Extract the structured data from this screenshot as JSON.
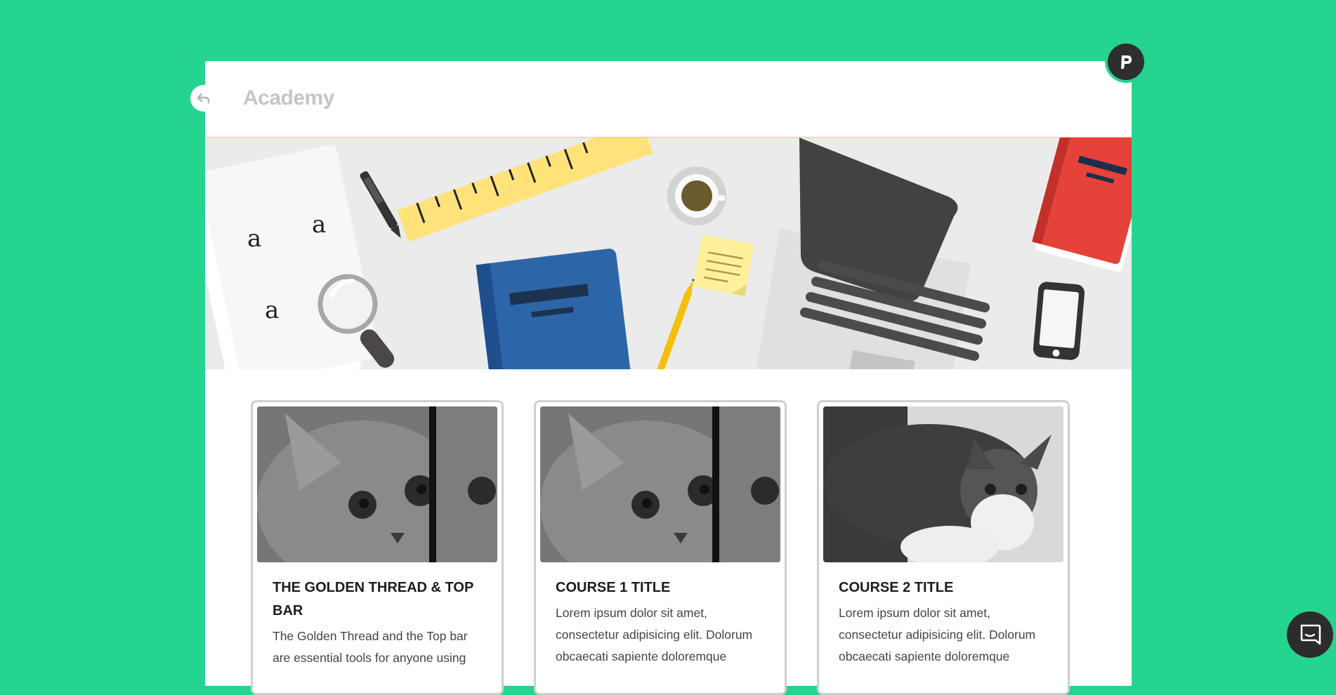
{
  "header": {
    "title": "Academy"
  },
  "logo": {
    "letter": "P"
  },
  "hero": {
    "paper_letters": [
      "a",
      "a",
      "a"
    ]
  },
  "cards": [
    {
      "title": "THE GOLDEN THREAD & TOP BAR",
      "text": "The Golden Thread and the Top bar are essential tools for anyone using",
      "image": "kitten-closeup"
    },
    {
      "title": "COURSE 1 TITLE",
      "text": "Lorem ipsum dolor sit amet, consectetur adipisicing elit. Dolorum obcaecati sapiente doloremque",
      "image": "kitten-closeup"
    },
    {
      "title": "COURSE 2 TITLE",
      "text": "Lorem ipsum dolor sit amet, consectetur adipisicing elit. Dolorum obcaecati sapiente doloremque",
      "image": "kitten-standing"
    }
  ],
  "colors": {
    "background": "#25d48e",
    "panel": "#ffffff",
    "header_border": "#f3c37a",
    "title": "#c5c5c5",
    "card_border": "#cfcfcf"
  },
  "icons": {
    "back": "undo-arrow-icon",
    "logo": "p-logo-icon",
    "chat": "chat-icon"
  }
}
